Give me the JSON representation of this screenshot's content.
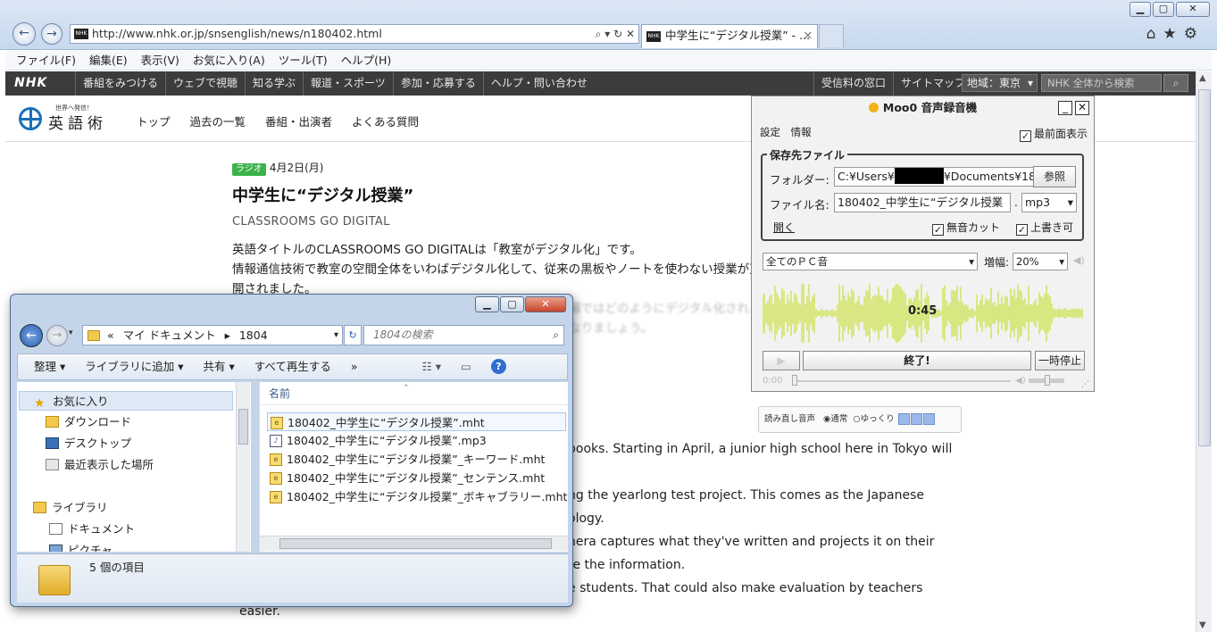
{
  "browser": {
    "url": "http://www.nhk.or.jp/snsenglish/news/n180402.html",
    "tab_title": "中学生に“デジタル授業” - ...",
    "favicon_text": "NHK",
    "menu": [
      "ファイル(F)",
      "編集(E)",
      "表示(V)",
      "お気に入り(A)",
      "ツール(T)",
      "ヘルプ(H)"
    ]
  },
  "nhk_bar": {
    "logo": "NHK",
    "nav": [
      "番組をみつける",
      "ウェブで視聴",
      "知る学ぶ",
      "報道・スポーツ",
      "参加・応募する",
      "ヘルプ・問い合わせ"
    ],
    "right_nav": [
      "受信料の窓口",
      "サイトマップ"
    ],
    "region": "地域：東京",
    "search_placeholder": "NHK 全体から検索"
  },
  "site": {
    "logo_small": "世界へ発信！",
    "logo": "英語術",
    "nav": [
      "トップ",
      "過去の一覧",
      "番組・出演者",
      "よくある質問"
    ]
  },
  "article": {
    "badge": "ラジオ",
    "date": "4月2日(月)",
    "title": "中学生に“デジタル授業”",
    "subtitle": "CLASSROOMS GO DIGITAL",
    "jp_lines": [
      "英語タイトルのCLASSROOMS GO DIGITALは「教室がデジタル化」です。",
      "情報通信技術で教室の空間全体をいわばデジタル化して、従来の黒板やノートを使わない授業が東京都内の学校で公",
      "開されました。",
      "さまざまな分野でデジタル技術が活用されていますが、教育現場ではどのようにデジタル化されるのでしょうか？",
      "オンラインの授業が始まるように、英語でも説明できるようになりましょう。"
    ],
    "en_lines": [
      "books. Starting in April, a junior high school here in Tokyo will",
      "",
      "ng the yearlong test project. This comes as the Japanese",
      "ology.",
      "nera captures what they've written and projects it on their",
      "re the information.",
      "e students. That could also make evaluation by teachers",
      "easier."
    ],
    "speech": {
      "label": "読み直し音声",
      "opt1": "通常",
      "opt2": "ゆっくり"
    }
  },
  "moo": {
    "title": "Moo0 音声録音機",
    "menu": [
      "設定",
      "情報"
    ],
    "topmost_label": "最前面表示",
    "group_label": "保存先ファイル",
    "folder_label": "フォルダー:",
    "folder_pre": "C:¥Users¥",
    "folder_post": "¥Documents¥18",
    "browse": "参照",
    "filename_label": "ファイル名:",
    "filename": "180402_中学生に“デジタル授業",
    "dot": ".",
    "ext": "mp3",
    "open": "開く",
    "silence_cut": "無音カット",
    "overwrite": "上書き可",
    "source": "全てのＰＣ音",
    "gain_label": "増幅:",
    "gain": "20%",
    "elapsed": "0:45",
    "stop": "終了!",
    "pause": "一時停止",
    "pos": "0:00",
    "accent": "#c9e03a"
  },
  "explorer": {
    "breadcrumb": [
      "«",
      "マイ ドキュメント",
      "1804"
    ],
    "search_placeholder": "1804の検索",
    "toolbar": [
      "整理 ▾",
      "ライブラリに追加 ▾",
      "共有 ▾",
      "すべて再生する",
      "»"
    ],
    "nav": [
      {
        "label": "お気に入り",
        "icon": "star-icon"
      },
      {
        "label": "ダウンロード",
        "icon": "download-icon"
      },
      {
        "label": "デスクトップ",
        "icon": "desktop-icon"
      },
      {
        "label": "最近表示した場所",
        "icon": "recent-icon"
      },
      {
        "label": "ライブラリ",
        "icon": "library-icon"
      },
      {
        "label": "ドキュメント",
        "icon": "documents-icon"
      },
      {
        "label": "ピクチャ",
        "icon": "pictures-icon"
      }
    ],
    "column_header": "名前",
    "files": [
      "180402_中学生に“デジタル授業”.mht",
      "180402_中学生に“デジタル授業”.mp3",
      "180402_中学生に“デジタル授業”_キーワード.mht",
      "180402_中学生に“デジタル授業”_センテンス.mht",
      "180402_中学生に“デジタル授業”_ボキャブラリー.mht"
    ],
    "status": "5 個の項目"
  }
}
